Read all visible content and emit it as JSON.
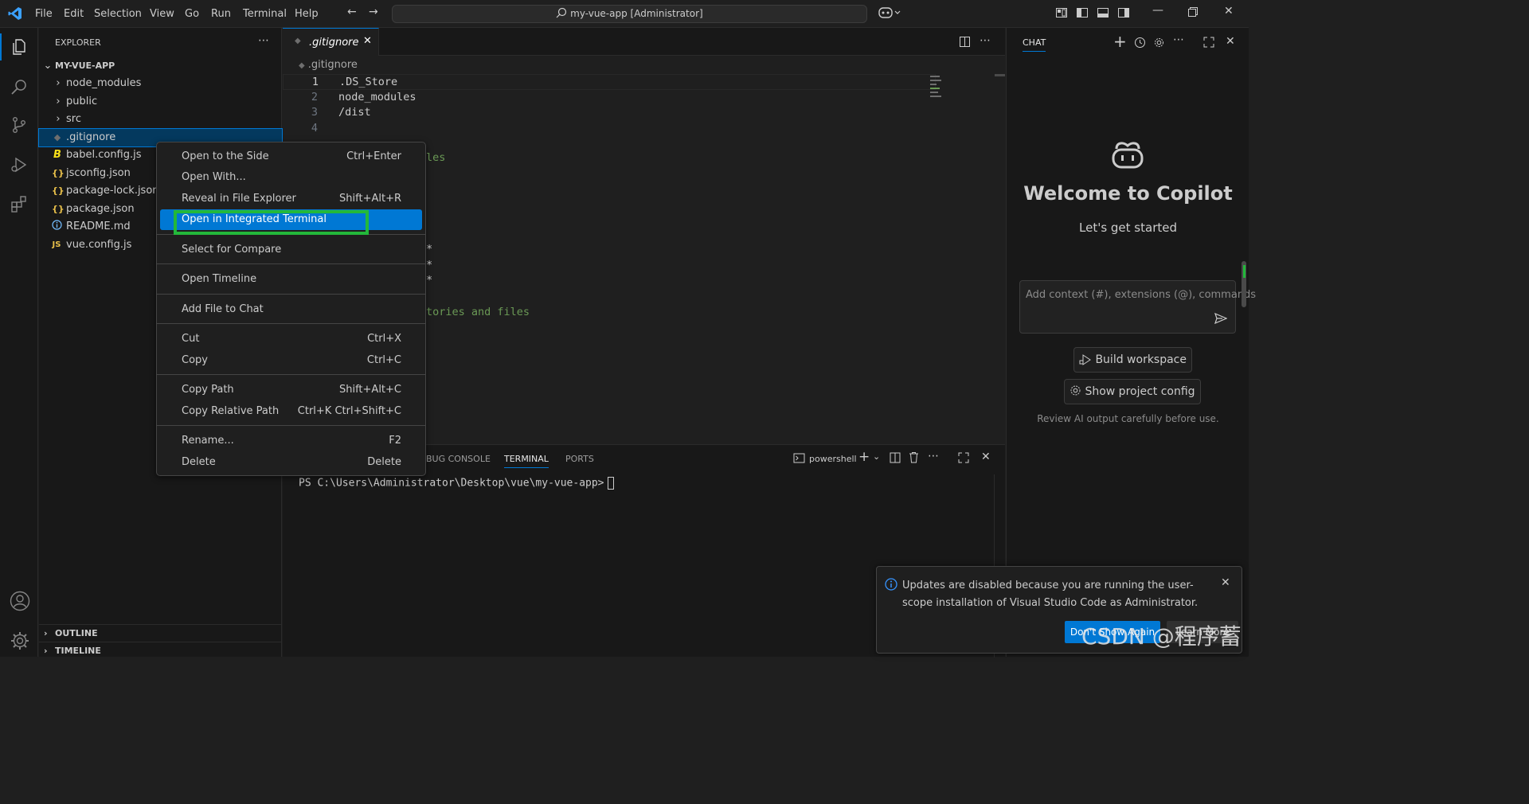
{
  "titlebar": {
    "menus": [
      "File",
      "Edit",
      "Selection",
      "View",
      "Go",
      "Run",
      "Terminal",
      "Help"
    ],
    "search_text": "my-vue-app [Administrator]"
  },
  "explorer": {
    "header": "EXPLORER",
    "root": "MY-VUE-APP",
    "items": [
      {
        "label": "node_modules",
        "kind": "folder"
      },
      {
        "label": "public",
        "kind": "folder"
      },
      {
        "label": "src",
        "kind": "folder"
      },
      {
        "label": ".gitignore",
        "kind": "file"
      },
      {
        "label": "babel.config.js",
        "kind": "file"
      },
      {
        "label": "jsconfig.json",
        "kind": "file"
      },
      {
        "label": "package-lock.json",
        "kind": "file"
      },
      {
        "label": "package.json",
        "kind": "file"
      },
      {
        "label": "README.md",
        "kind": "file"
      },
      {
        "label": "vue.config.js",
        "kind": "file"
      }
    ],
    "outline": "OUTLINE",
    "timeline": "TIMELINE"
  },
  "editor": {
    "tab_label": ".gitignore",
    "breadcrumb": ".gitignore",
    "lines": [
      {
        "n": "1",
        "text": ".DS_Store"
      },
      {
        "n": "2",
        "text": "node_modules"
      },
      {
        "n": "3",
        "text": "/dist"
      },
      {
        "n": "4",
        "text": ""
      }
    ],
    "visible_fragments": {
      "les": "les",
      "star1": "*",
      "star2": "*",
      "star3": "*",
      "tories": "tories and files"
    }
  },
  "context_menu": {
    "items": [
      {
        "label": "Open to the Side",
        "key": "Ctrl+Enter"
      },
      {
        "label": "Open With...",
        "key": ""
      },
      {
        "label": "Reveal in File Explorer",
        "key": "Shift+Alt+R"
      },
      {
        "label": "Open in Integrated Terminal",
        "key": ""
      },
      {
        "label": "Select for Compare",
        "key": ""
      },
      {
        "label": "Open Timeline",
        "key": ""
      },
      {
        "label": "Add File to Chat",
        "key": ""
      },
      {
        "label": "Cut",
        "key": "Ctrl+X"
      },
      {
        "label": "Copy",
        "key": "Ctrl+C"
      },
      {
        "label": "Copy Path",
        "key": "Shift+Alt+C"
      },
      {
        "label": "Copy Relative Path",
        "key": "Ctrl+K Ctrl+Shift+C"
      },
      {
        "label": "Rename...",
        "key": "F2"
      },
      {
        "label": "Delete",
        "key": "Delete"
      }
    ]
  },
  "panel": {
    "tabs": [
      "BUG CONSOLE",
      "TERMINAL",
      "PORTS"
    ],
    "shell": "powershell",
    "prompt": "PS C:\\Users\\Administrator\\Desktop\\vue\\my-vue-app>"
  },
  "chat": {
    "header": "CHAT",
    "title": "Welcome to Copilot",
    "subtitle": "Let's get started",
    "input_placeholder": "Add context (#), extensions (@), commands",
    "btn_build": "Build workspace",
    "btn_config": "Show project config",
    "note": "Review AI output carefully before use."
  },
  "notification": {
    "message": "Updates are disabled because you are running the user-scope installation of Visual Studio Code as Administrator.",
    "btn_primary": "Don't Show Again",
    "btn_secondary": "Learn More"
  },
  "watermark": "CSDN @程序蓄",
  "colors": {
    "accent": "#0078d4",
    "highlight_box": "#23b83a",
    "background": "#1f1f1f"
  }
}
